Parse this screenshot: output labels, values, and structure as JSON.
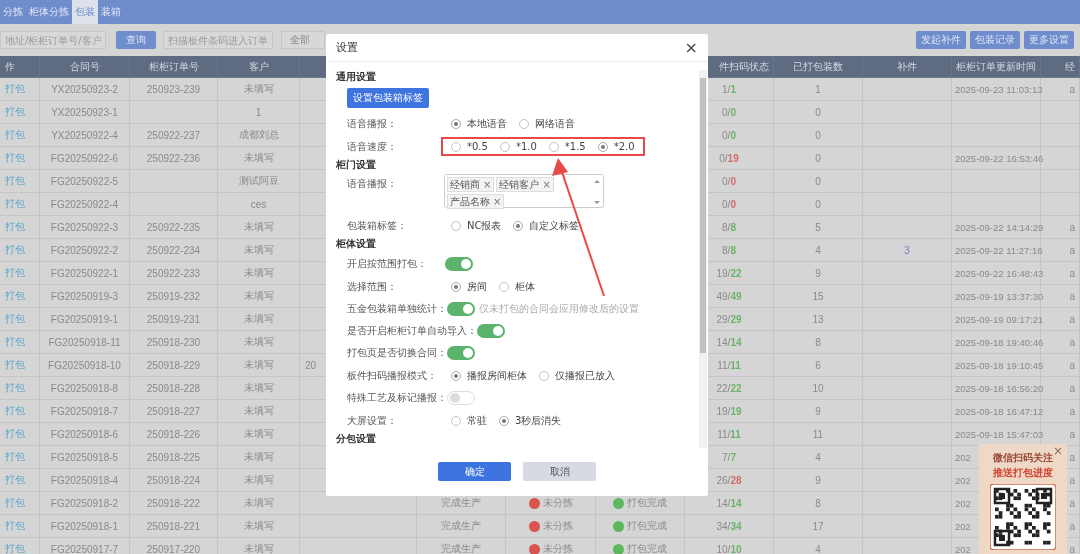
{
  "nav": {
    "tabs": [
      {
        "label": "分拣",
        "selected": false
      },
      {
        "label": "柜体分拣",
        "selected": false
      },
      {
        "label": "包装",
        "selected": true
      },
      {
        "label": "装箱",
        "selected": false
      }
    ]
  },
  "toolbar": {
    "search": {
      "placeholder": "地址/柜柜订单号/客户"
    },
    "query_button": "查询",
    "scan": {
      "placeholder": "扫描板件条码进入订单"
    },
    "filter": {
      "value": "全部"
    },
    "buttons": [
      "发起补件",
      "包装记录",
      "更多设置"
    ]
  },
  "table": {
    "columns": [
      "作",
      "合同号",
      "柜柜订单号",
      "客户",
      "件扫码状态",
      "已打包装数",
      "补件",
      "柜柜订单更新时间",
      "经"
    ],
    "rows": [
      {
        "action": "打包",
        "contract": "YX20250923-2",
        "order": "250923-239",
        "customer": "未填写",
        "scan": {
          "scanned": "1/",
          "total": "1",
          "color": "#6bb36b"
        },
        "packed": "1",
        "updated": "2025-09-23 11:03:13",
        "column_13": "a"
      },
      {
        "action": "打包",
        "contract": "YX20250923-1",
        "customer": "1",
        "scan": {
          "scanned": "0/",
          "total": "0",
          "color": "#6bb36b"
        },
        "packed": "0"
      },
      {
        "action": "打包",
        "contract": "YX20250922-4",
        "order": "250922-237",
        "customer": "成都刘总",
        "scan": {
          "scanned": "0/",
          "total": "0",
          "color": "#6bb36b"
        },
        "packed": "0"
      },
      {
        "action": "打包",
        "contract": "FG20250922-6",
        "order": "250922-236",
        "customer": "未填写",
        "scan": {
          "scanned": "0/",
          "total": "19",
          "color": "#d46a6a"
        },
        "packed": "0",
        "updated": "2025-09-22 16:53:46"
      },
      {
        "action": "打包",
        "contract": "FG20250922-5",
        "customer": "测试阿豆",
        "scan": {
          "scanned": "0/",
          "total": "0",
          "color": "#d46a6a"
        },
        "packed": "0"
      },
      {
        "action": "打包",
        "contract": "FG20250922-4",
        "customer": "ces",
        "scan": {
          "scanned": "0/",
          "total": "0",
          "color": "#d46a6a"
        },
        "packed": "0"
      },
      {
        "action": "打包",
        "contract": "FG20250922-3",
        "order": "250922-235",
        "customer": "未填写",
        "scan": {
          "scanned": "8/",
          "total": "8",
          "color": "#6bb36b"
        },
        "packed": "5",
        "updated": "2025-09-22 14:14:29",
        "column_13": "a"
      },
      {
        "action": "打包",
        "contract": "FG20250922-2",
        "order": "250922-234",
        "customer": "未填写",
        "scan": {
          "scanned": "8/",
          "total": "8",
          "color": "#6bb36b"
        },
        "packed": "4",
        "supplement": "3",
        "updated": "2025-09-22 11:27:16",
        "column_13": "a"
      },
      {
        "action": "打包",
        "contract": "FG20250922-1",
        "order": "250922-233",
        "customer": "未填写",
        "scan": {
          "scanned": "19/",
          "total": "22",
          "color": "#6bb36b"
        },
        "packed": "9",
        "updated": "2025-09-22 16:48:43",
        "column_13": "a"
      },
      {
        "action": "打包",
        "contract": "FG20250919-3",
        "order": "250919-232",
        "customer": "未填写",
        "scan": {
          "scanned": "49/",
          "total": "49",
          "color": "#6bb36b"
        },
        "packed": "15",
        "updated": "2025-09-19 13:37:30",
        "column_13": "a"
      },
      {
        "action": "打包",
        "contract": "FG20250919-1",
        "order": "250919-231",
        "customer": "未填写",
        "scan": {
          "scanned": "29/",
          "total": "29",
          "color": "#6bb36b"
        },
        "packed": "13",
        "updated": "2025-09-19 09:17:21",
        "column_13": "a"
      },
      {
        "action": "打包",
        "contract": "FG20250918-11",
        "order": "250918-230",
        "customer": "未填写",
        "scan": {
          "scanned": "14/",
          "total": "14",
          "color": "#6bb36b"
        },
        "packed": "8",
        "updated": "2025-09-18 19:40:46",
        "column_13": "a"
      },
      {
        "action": "打包",
        "contract": "FG20250918-10",
        "order": "250918-229",
        "customer": "未填写",
        "column_5": "20",
        "scan": {
          "scanned": "11/",
          "total": "11",
          "color": "#6bb36b"
        },
        "packed": "6",
        "updated": "2025-09-18 19:10:45",
        "column_13": "a"
      },
      {
        "action": "打包",
        "contract": "FG20250918-8",
        "order": "250918-228",
        "customer": "未填写",
        "scan": {
          "scanned": "22/",
          "total": "22",
          "color": "#6bb36b"
        },
        "packed": "10",
        "updated": "2025-09-18 16:56:20",
        "column_13": "a"
      },
      {
        "action": "打包",
        "contract": "FG20250918-7",
        "order": "250918-227",
        "customer": "未填写",
        "scan": {
          "scanned": "19/",
          "total": "19",
          "color": "#6bb36b"
        },
        "packed": "9",
        "updated": "2025-09-18 16:47:12",
        "column_13": "a"
      },
      {
        "action": "打包",
        "contract": "FG20250918-6",
        "order": "250918-226",
        "customer": "未填写",
        "scan": {
          "scanned": "11/",
          "total": "11",
          "color": "#6bb36b"
        },
        "packed": "11",
        "updated": "2025-09-18 15:47:03",
        "column_13": "a"
      },
      {
        "action": "打包",
        "contract": "FG20250918-5",
        "order": "250918-225",
        "customer": "未填写",
        "scan": {
          "scanned": "7/",
          "total": "7",
          "color": "#6bb36b"
        },
        "packed": "4",
        "updated": "202",
        "column_13": "a"
      },
      {
        "action": "打包",
        "contract": "FG20250918-4",
        "order": "250918-224",
        "customer": "未填写",
        "scan": {
          "scanned": "26/",
          "total": "28",
          "color": "#d46a6a"
        },
        "packed": "9",
        "updated": "202",
        "column_13": "a"
      },
      {
        "action": "打包",
        "contract": "FG20250918-2",
        "order": "250918-222",
        "customer": "未填写",
        "production": "完成生产",
        "sort_status": {
          "label": "未分拣",
          "color": "#d9534f"
        },
        "pack_status": {
          "label": "打包完成",
          "color": "#5cb85c"
        },
        "scan": {
          "scanned": "14/",
          "total": "14",
          "color": "#6bb36b"
        },
        "packed": "8",
        "updated": "202",
        "column_13": "a"
      },
      {
        "action": "打包",
        "contract": "FG20250918-1",
        "order": "250918-221",
        "customer": "未填写",
        "production": "完成生产",
        "sort_status": {
          "label": "未分拣",
          "color": "#d9534f"
        },
        "pack_status": {
          "label": "打包完成",
          "color": "#5cb85c"
        },
        "scan": {
          "scanned": "34/",
          "total": "34",
          "color": "#6bb36b"
        },
        "packed": "17",
        "updated": "202",
        "column_13": "a"
      },
      {
        "action": "打包",
        "contract": "FG20250917-7",
        "order": "250917-220",
        "customer": "未填写",
        "production": "完成生产",
        "sort_status": {
          "label": "未分拣",
          "color": "#d9534f"
        },
        "pack_status": {
          "label": "打包完成",
          "color": "#5cb85c"
        },
        "scan": {
          "scanned": "10/",
          "total": "10",
          "color": "#6bb36b"
        },
        "packed": "4",
        "updated": "202",
        "column_13": "a"
      }
    ]
  },
  "dialog": {
    "title": "设置",
    "close": "×",
    "items": [
      {
        "kind": "section",
        "label": "通用设置"
      },
      {
        "kind": "button",
        "label": "设置包装箱标签"
      },
      {
        "kind": "radio",
        "label": "语音播报：",
        "options": [
          {
            "label": "本地语音",
            "selected": true
          },
          {
            "label": "网络语音",
            "selected": false
          }
        ]
      },
      {
        "kind": "radio",
        "label": "语音速度：",
        "highlighted": true,
        "options": [
          {
            "label": "*0.5",
            "selected": false
          },
          {
            "label": "*1.0",
            "selected": false
          },
          {
            "label": "*1.5",
            "selected": false
          },
          {
            "label": "*2.0",
            "selected": true
          }
        ]
      },
      {
        "kind": "section",
        "label": "柜门设置"
      },
      {
        "kind": "tags",
        "label": "语音播报：",
        "tags": [
          {
            "label": "经销商",
            "remove": "×"
          },
          {
            "label": "经销客户",
            "remove": "×"
          },
          {
            "label": "产品名称",
            "remove": "×"
          }
        ]
      },
      {
        "kind": "radio",
        "label": "包装箱标签：",
        "options": [
          {
            "label": "NC报表",
            "selected": false
          },
          {
            "label": "自定义标签",
            "selected": true
          }
        ]
      },
      {
        "kind": "section",
        "label": "柜体设置"
      },
      {
        "kind": "toggle",
        "label": "开启按范围打包：",
        "on": true
      },
      {
        "kind": "radio",
        "label": "选择范围：",
        "options": [
          {
            "label": "房间",
            "selected": true
          },
          {
            "label": "柜体",
            "selected": false
          }
        ]
      },
      {
        "kind": "toggle",
        "label": "五金包装箱单独统计：",
        "on": true,
        "hint": "仅未打包的合同会应用修改后的设置"
      },
      {
        "kind": "toggle",
        "label": "是否开启柜柜订单自动导入：",
        "on": true
      },
      {
        "kind": "toggle",
        "label": "打包页是否切换合同：",
        "on": true
      },
      {
        "kind": "radio",
        "label": "板件扫码播报模式：",
        "options": [
          {
            "label": "播报房间柜体",
            "selected": true
          },
          {
            "label": "仅播报已放入",
            "selected": false
          }
        ]
      },
      {
        "kind": "toggle",
        "label": "特殊工艺及标记播报：",
        "on": false
      },
      {
        "kind": "radio",
        "label": "大屏设置：",
        "options": [
          {
            "label": "常驻",
            "selected": false
          },
          {
            "label": "3秒后消失",
            "selected": true
          }
        ]
      },
      {
        "kind": "section",
        "label": "分包设置"
      }
    ],
    "buttons": [
      {
        "label": "确定",
        "kind": "primary"
      },
      {
        "label": "取消",
        "kind": "secondary"
      }
    ]
  },
  "qr_popup": {
    "close": "×",
    "lines": [
      "微信扫码关注",
      "推送打包进度"
    ]
  }
}
